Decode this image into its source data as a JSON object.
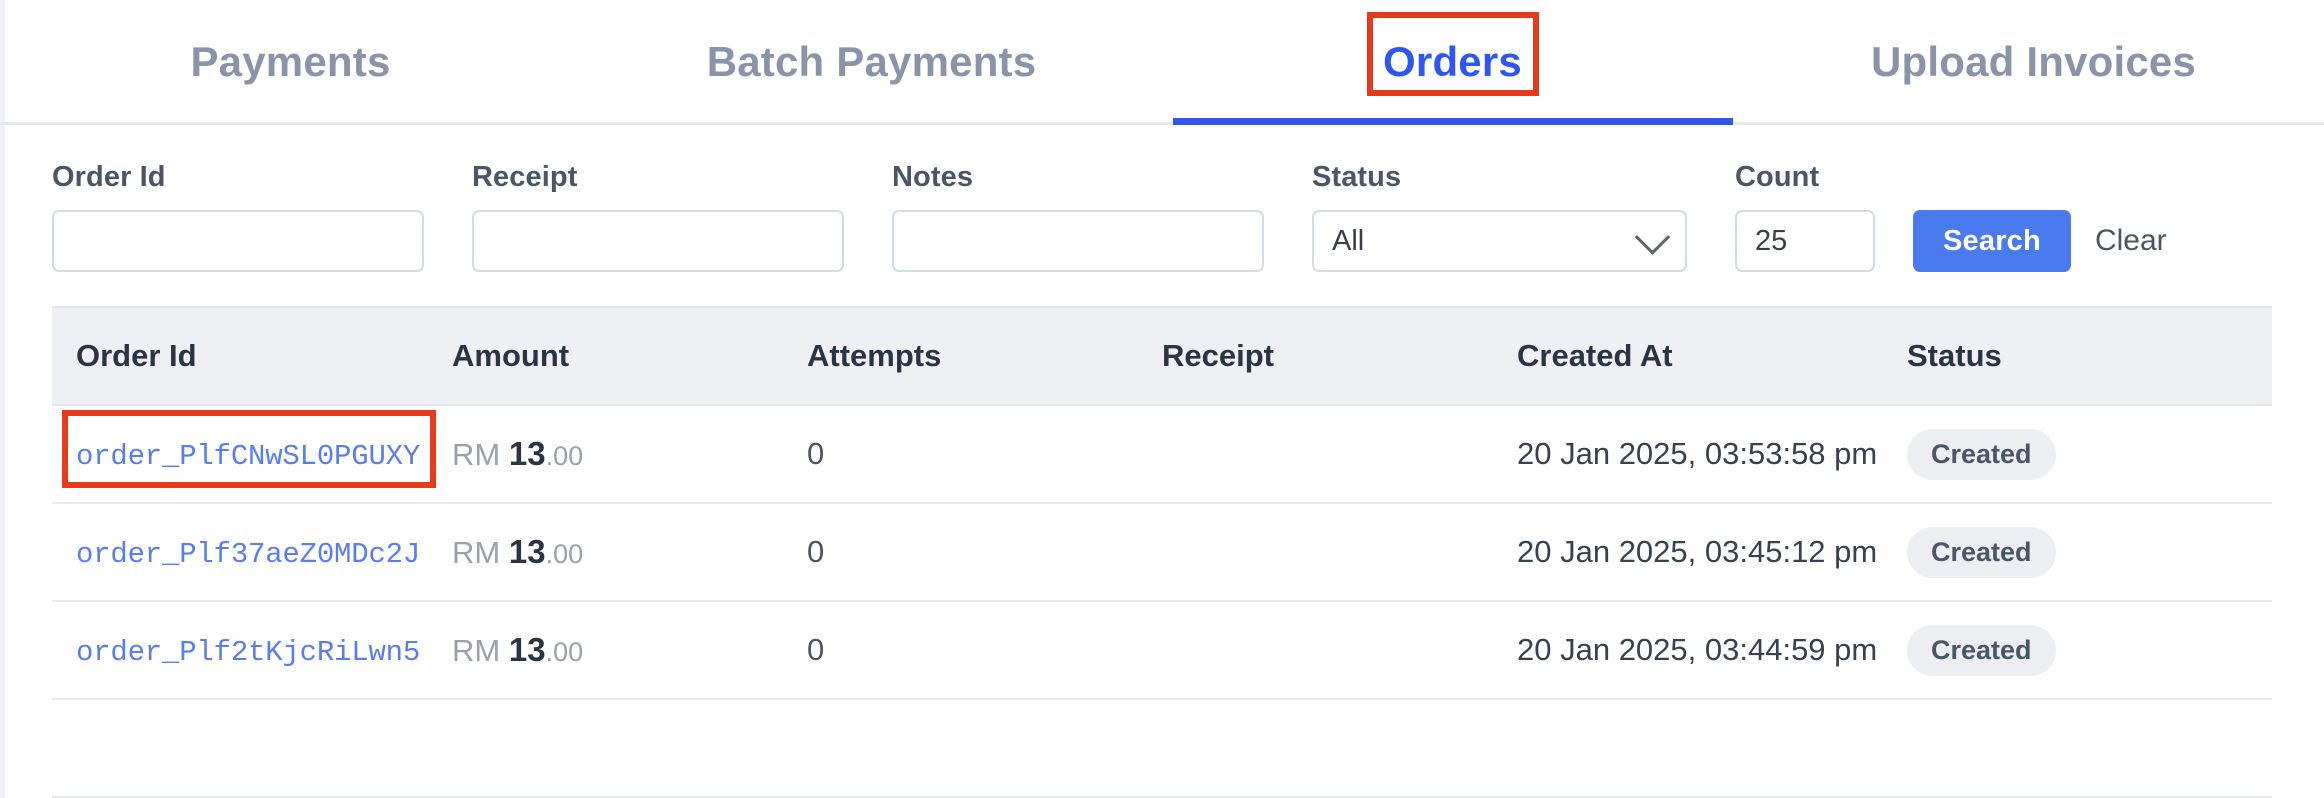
{
  "tabs": [
    {
      "label": "Payments",
      "active": false,
      "annotated": false
    },
    {
      "label": "Batch Payments",
      "active": false,
      "annotated": false
    },
    {
      "label": "Orders",
      "active": true,
      "annotated": true
    },
    {
      "label": "Upload Invoices",
      "active": false,
      "annotated": false
    }
  ],
  "filters": {
    "order_id": {
      "label": "Order Id",
      "value": "",
      "placeholder": ""
    },
    "receipt": {
      "label": "Receipt",
      "value": "",
      "placeholder": ""
    },
    "notes": {
      "label": "Notes",
      "value": "",
      "placeholder": ""
    },
    "status": {
      "label": "Status",
      "value": "All",
      "options": [
        "All"
      ]
    },
    "count": {
      "label": "Count",
      "value": "25",
      "placeholder": ""
    },
    "search_label": "Search",
    "clear_label": "Clear"
  },
  "table": {
    "columns": [
      "Order Id",
      "Amount",
      "Attempts",
      "Receipt",
      "Created At",
      "Status"
    ],
    "rows": [
      {
        "order_id": "order_PlfCNwSL0PGUXY",
        "amount_currency": "RM",
        "amount_integer": "13",
        "amount_decimal": ".00",
        "attempts": "0",
        "receipt": "",
        "created_at": "20 Jan 2025, 03:53:58 pm",
        "status": "Created",
        "annotated": true
      },
      {
        "order_id": "order_Plf37aeZ0MDc2J",
        "amount_currency": "RM",
        "amount_integer": "13",
        "amount_decimal": ".00",
        "attempts": "0",
        "receipt": "",
        "created_at": "20 Jan 2025, 03:45:12 pm",
        "status": "Created",
        "annotated": false
      },
      {
        "order_id": "order_Plf2tKjcRiLwn5",
        "amount_currency": "RM",
        "amount_integer": "13",
        "amount_decimal": ".00",
        "attempts": "0",
        "receipt": "",
        "created_at": "20 Jan 2025, 03:44:59 pm",
        "status": "Created",
        "annotated": false
      },
      {
        "order_id": "",
        "amount_currency": "",
        "amount_integer": "",
        "amount_decimal": "",
        "attempts": "",
        "receipt": "",
        "created_at": "",
        "status": "",
        "annotated": false
      }
    ]
  },
  "colors": {
    "accent_blue": "#3355ee",
    "link_blue": "#5b7cf0",
    "button_blue": "#4a7bee",
    "annotation_red": "#e8391b",
    "tab_inactive": "#8a94a8",
    "header_bg": "#eef0f4"
  }
}
